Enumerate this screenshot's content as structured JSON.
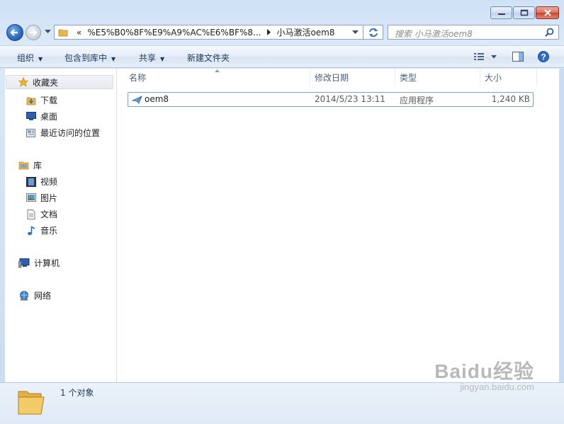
{
  "window": {
    "caption_buttons": [
      "minimize-icon",
      "maximize-icon",
      "close-icon"
    ]
  },
  "nav": {
    "address_overflow": "«",
    "address_path": "%E5%B0%8F%E9%A9%AC%E6%BF%8...",
    "address_current": "小马激活oem8",
    "search_placeholder": "搜索 小马激活oem8"
  },
  "toolbar": {
    "organize": "组织",
    "include_in_library": "包含到库中",
    "share": "共享",
    "new_folder": "新建文件夹"
  },
  "sidebar": {
    "favorites": {
      "label": "收藏夹",
      "items": [
        {
          "label": "下载",
          "icon": "download-folder-icon"
        },
        {
          "label": "桌面",
          "icon": "desktop-icon"
        },
        {
          "label": "最近访问的位置",
          "icon": "recent-places-icon"
        }
      ]
    },
    "libraries": {
      "label": "库",
      "items": [
        {
          "label": "视频",
          "icon": "video-library-icon"
        },
        {
          "label": "图片",
          "icon": "pictures-library-icon"
        },
        {
          "label": "文档",
          "icon": "documents-library-icon"
        },
        {
          "label": "音乐",
          "icon": "music-library-icon"
        }
      ]
    },
    "computer": "计算机",
    "network": "网络"
  },
  "table": {
    "columns": [
      "名称",
      "修改日期",
      "类型",
      "大小"
    ],
    "rows": [
      {
        "name": "oem8",
        "modified": "2014/5/23 13:11",
        "type": "应用程序",
        "size": "1,240 KB"
      }
    ]
  },
  "status": {
    "count": "1 个对象"
  },
  "watermark": {
    "brand": "Baidu经验",
    "url": "jingyan.baidu.com"
  },
  "colors": {
    "accent": "#2d6ec4",
    "command_text": "#1e395b",
    "selection_border": "#7da2ce"
  }
}
